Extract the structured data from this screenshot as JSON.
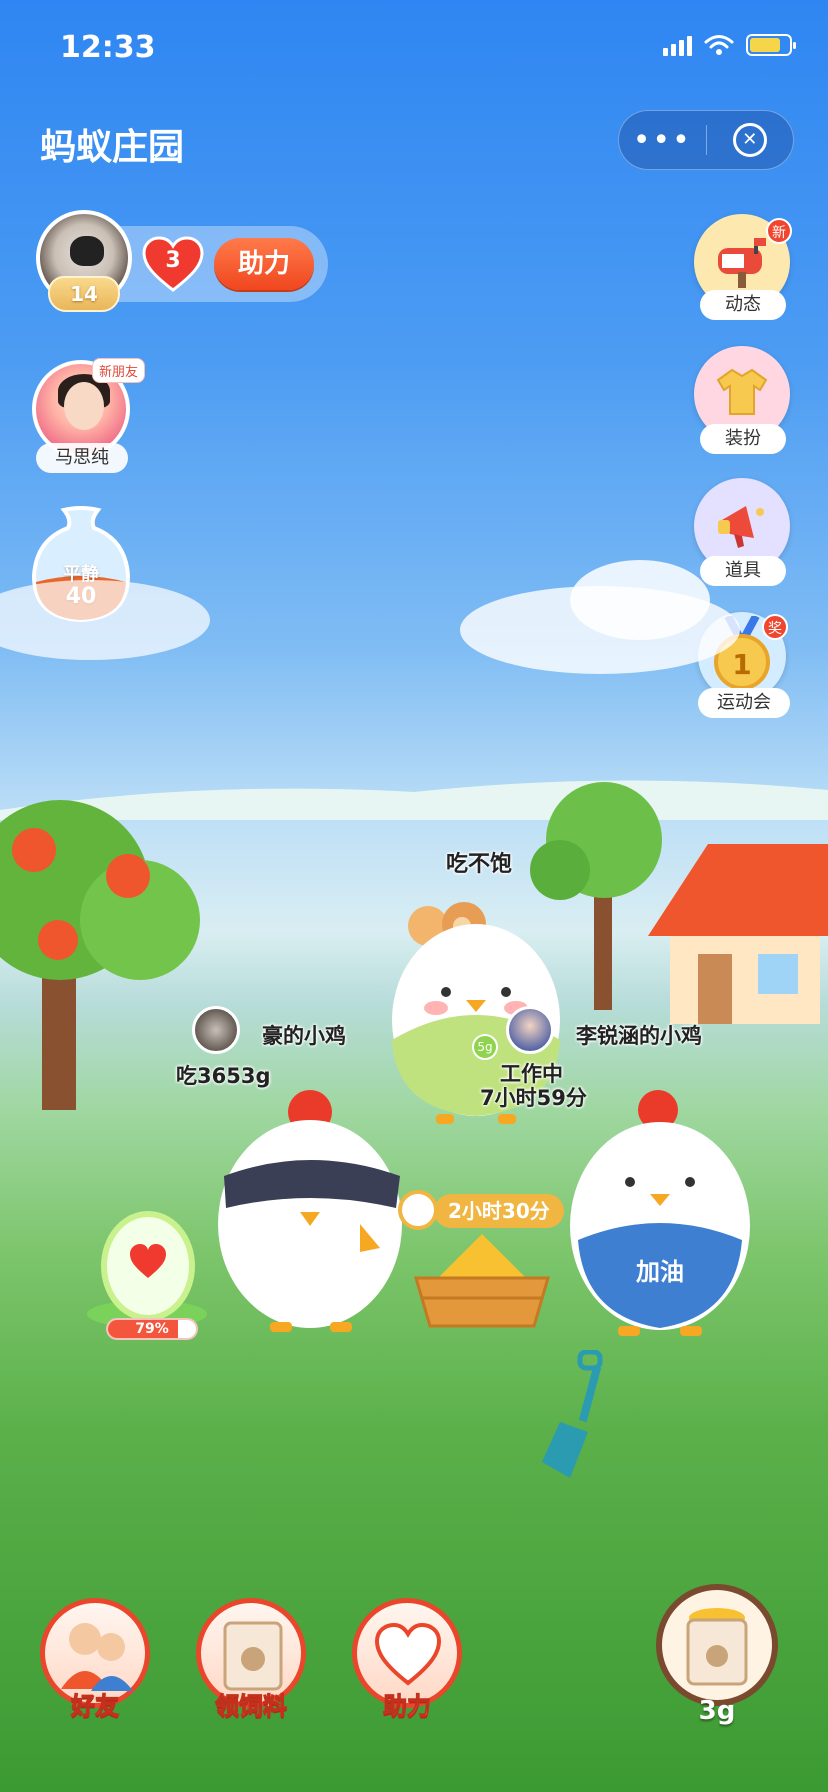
{
  "status_bar": {
    "time": "12:33"
  },
  "nav": {
    "title": "蚂蚁庄园",
    "more_label": "•••",
    "close_label": "✕"
  },
  "player": {
    "level": "14",
    "hearts": "3",
    "help_label": "助力"
  },
  "friend": {
    "name": "马思纯",
    "tag": "新朋友"
  },
  "mood": {
    "label": "平静",
    "value": "40"
  },
  "side_menu": {
    "items": [
      {
        "label": "动态",
        "badge": "新",
        "icon": "mailbox-icon"
      },
      {
        "label": "装扮",
        "icon": "tshirt-icon"
      },
      {
        "label": "道具",
        "icon": "megaphone-icon"
      },
      {
        "label": "运动会",
        "badge": "奖",
        "medal": "1",
        "icon": "medal-icon"
      }
    ]
  },
  "scene": {
    "status_hungry": "吃不饱",
    "my_chicken": {
      "name": "豪的小鸡",
      "ate": "吃3653g"
    },
    "friend_chicken": {
      "name": "李锐涵的小鸡",
      "status": "工作中",
      "time": "7小时59分",
      "coin_label": "5g"
    },
    "feed_timer": "2小时30分",
    "apron_text": "加油",
    "egg_progress": "79%",
    "colors": {
      "accent_red": "#e9462b",
      "sky": "#2f86f2",
      "grass": "#5bb04a"
    }
  },
  "bottom_nav": {
    "friends_label": "好友",
    "feed_label": "领饲料",
    "help_label": "助力",
    "feed_amount": "3g"
  }
}
